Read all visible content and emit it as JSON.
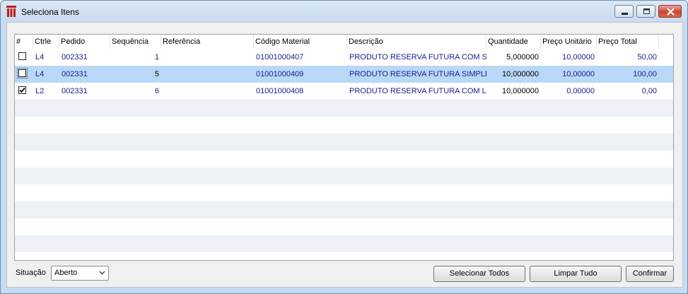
{
  "window": {
    "title": "Seleciona Itens"
  },
  "grid": {
    "columns": [
      "#",
      "Ctrle",
      "Pedido",
      "Sequência",
      "Referência",
      "Código Material",
      "Descrição",
      "Quantidade",
      "Preço Unitário",
      "Preço Total"
    ],
    "rows": [
      {
        "checked": false,
        "ctrle": "L4",
        "pedido": "002331",
        "sequencia": "1",
        "referencia": "",
        "codigo": "01001000407",
        "descricao": "PRODUTO RESERVA FUTURA COM SERIE",
        "quantidade": "5,000000",
        "preco_unitario": "10,00000",
        "preco_total": "50,00"
      },
      {
        "checked": false,
        "ctrle": "L4",
        "pedido": "002331",
        "sequencia": "5",
        "referencia": "",
        "codigo": "01001000409",
        "descricao": "PRODUTO RESERVA FUTURA SIMPLES C",
        "quantidade": "10,000000",
        "preco_unitario": "10,00000",
        "preco_total": "100,00"
      },
      {
        "checked": true,
        "ctrle": "L2",
        "pedido": "002331",
        "sequencia": "6",
        "referencia": "",
        "codigo": "01001000408",
        "descricao": "PRODUTO RESERVA FUTURA  COM LOTE",
        "quantidade": "10,000000",
        "preco_unitario": "0,00000",
        "preco_total": "0,00"
      }
    ]
  },
  "footer": {
    "situacao_label": "Situação",
    "situacao_value": "Aberto",
    "selecionar_todos": "Selecionar Todos",
    "limpar_tudo": "Limpar Tudo",
    "confirmar": "Confirmar"
  }
}
